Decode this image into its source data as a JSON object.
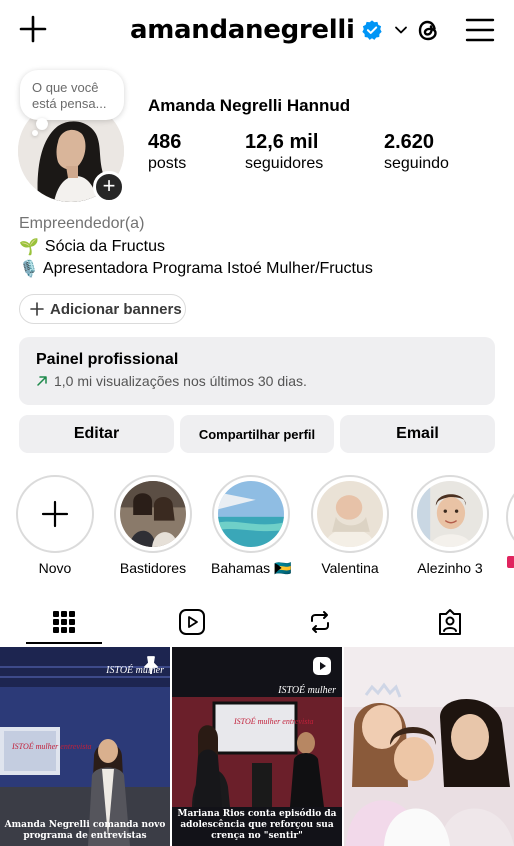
{
  "header": {
    "username": "amandanegrelli",
    "icons": [
      "plus-icon",
      "verified-badge-icon",
      "chevron-down-icon",
      "threads-icon",
      "menu-icon"
    ]
  },
  "note": {
    "text": "O que você está pensa..."
  },
  "profile": {
    "full_name": "Amanda Negrelli Hannud",
    "stats": [
      {
        "value": "486",
        "label": "posts"
      },
      {
        "value": "12,6 mil",
        "label": "seguidores"
      },
      {
        "value": "2.620",
        "label": "seguindo"
      }
    ],
    "category": "Empreendedor(a)",
    "bio_lines": [
      {
        "emoji": "🌱",
        "text": "Sócia da Fructus"
      },
      {
        "emoji": "🎙️",
        "text": "Apresentadora Programa Istoé Mulher/Fructus"
      }
    ]
  },
  "add_banners_label": "Adicionar banners",
  "professional_panel": {
    "title": "Painel profissional",
    "subtitle": "1,0 mi visualizações nos últimos 30 dias.",
    "trend_color": "#1f8a4c"
  },
  "actions": {
    "edit": "Editar",
    "share": "Compartilhar perfil",
    "email": "Email"
  },
  "highlights": [
    {
      "label": "Novo"
    },
    {
      "label": "Bastidores"
    },
    {
      "label": "Bahamas 🇧🇸"
    },
    {
      "label": "Valentina"
    },
    {
      "label": "Alezinho 3"
    }
  ],
  "tabs": [
    "grid-icon",
    "reels-icon",
    "reposts-icon",
    "tagged-icon"
  ],
  "posts": [
    {
      "brand": "ISTOÉ mulher",
      "tv_text": "ISTOÉ mulher entrevista",
      "caption": "Amanda Negrelli comanda novo programa de entrevistas"
    },
    {
      "brand": "ISTOÉ mulher",
      "tv_text": "ISTOÉ mulher entrevista",
      "caption": "Mariana Rios conta episódio da adolescência que reforçou sua crença no \"sentir\""
    },
    {
      "caption": ""
    }
  ],
  "colors": {
    "verified": "#0095f6",
    "button_bg": "#efeff1",
    "accent": "#000000"
  }
}
